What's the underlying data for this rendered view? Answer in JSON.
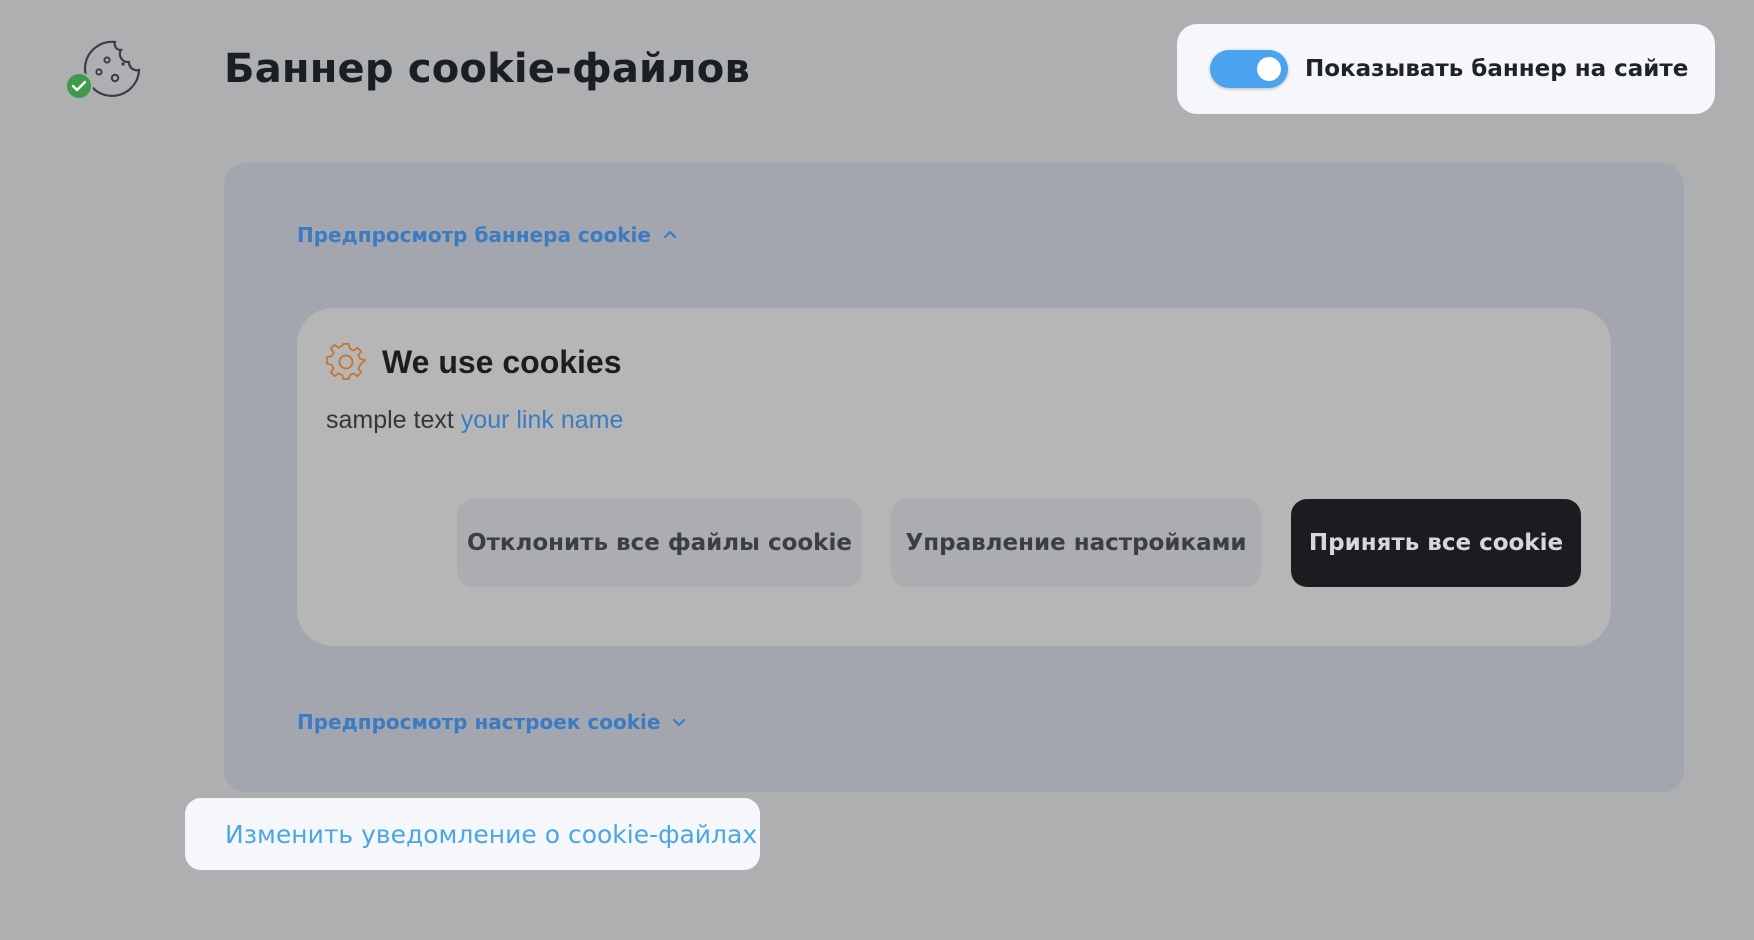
{
  "header": {
    "title": "Баннер cookie-файлов",
    "logo_icon": "cookie-consent-icon",
    "toggle": {
      "label": "Показывать баннер на сайте",
      "checked": true,
      "accent_color": "#4aa3ee"
    }
  },
  "preview": {
    "banner_toggle_label": "Предпросмотр баннера cookie",
    "banner_toggle_state": "expanded",
    "settings_toggle_label": "Предпросмотр настроек cookie",
    "settings_toggle_state": "collapsed",
    "banner": {
      "icon": "gear-icon",
      "icon_color": "#c4742f",
      "title": "We use cookies",
      "text": "sample text",
      "link_text": "your link name",
      "buttons": {
        "reject": "Отклонить все файлы cookie",
        "manage": "Управление настройками",
        "accept": "Принять все cookie"
      }
    }
  },
  "footer": {
    "edit_link": "Изменить уведомление о cookie-файлах"
  },
  "colors": {
    "link": "#3a7bc2",
    "accept_button": "#1a1c1f"
  }
}
